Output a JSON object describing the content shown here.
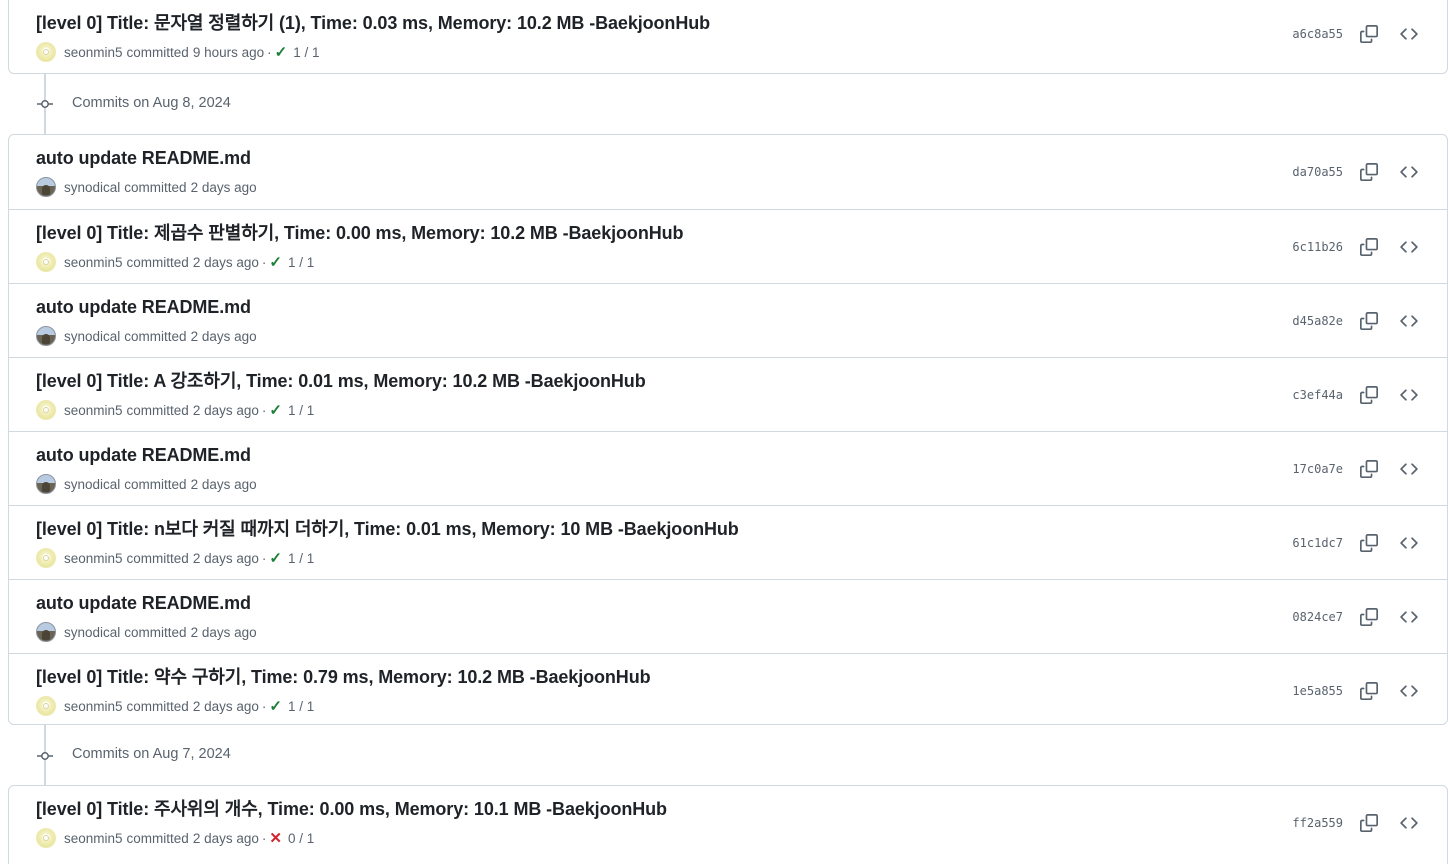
{
  "top_group": {
    "commits": [
      {
        "title": "[level 0] Title: 문자열 정렬하기 (1), Time: 0.03 ms, Memory: 10.2 MB -BaekjoonHub",
        "author": "seonmin5",
        "verb": "committed",
        "time": "9 hours ago",
        "status": "success",
        "status_count": "1 / 1",
        "sha": "a6c8a55"
      }
    ]
  },
  "groups": [
    {
      "label": "Commits on Aug 8, 2024",
      "commits": [
        {
          "title": "auto update README.md",
          "author": "synodical",
          "verb": "committed",
          "time": "2 days ago",
          "status": "",
          "status_count": "",
          "sha": "da70a55"
        },
        {
          "title": "[level 0] Title: 제곱수 판별하기, Time: 0.00 ms, Memory: 10.2 MB -BaekjoonHub",
          "author": "seonmin5",
          "verb": "committed",
          "time": "2 days ago",
          "status": "success",
          "status_count": "1 / 1",
          "sha": "6c11b26"
        },
        {
          "title": "auto update README.md",
          "author": "synodical",
          "verb": "committed",
          "time": "2 days ago",
          "status": "",
          "status_count": "",
          "sha": "d45a82e"
        },
        {
          "title": "[level 0] Title: A 강조하기, Time: 0.01 ms, Memory: 10.2 MB -BaekjoonHub",
          "author": "seonmin5",
          "verb": "committed",
          "time": "2 days ago",
          "status": "success",
          "status_count": "1 / 1",
          "sha": "c3ef44a"
        },
        {
          "title": "auto update README.md",
          "author": "synodical",
          "verb": "committed",
          "time": "2 days ago",
          "status": "",
          "status_count": "",
          "sha": "17c0a7e"
        },
        {
          "title": "[level 0] Title: n보다 커질 때까지 더하기, Time: 0.01 ms, Memory: 10 MB -BaekjoonHub",
          "author": "seonmin5",
          "verb": "committed",
          "time": "2 days ago",
          "status": "success",
          "status_count": "1 / 1",
          "sha": "61c1dc7"
        },
        {
          "title": "auto update README.md",
          "author": "synodical",
          "verb": "committed",
          "time": "2 days ago",
          "status": "",
          "status_count": "",
          "sha": "0824ce7"
        },
        {
          "title": "[level 0] Title: 약수 구하기, Time: 0.79 ms, Memory: 10.2 MB -BaekjoonHub",
          "author": "seonmin5",
          "verb": "committed",
          "time": "2 days ago",
          "status": "success",
          "status_count": "1 / 1",
          "sha": "1e5a855"
        }
      ]
    },
    {
      "label": "Commits on Aug 7, 2024",
      "commits": [
        {
          "title": "[level 0] Title: 주사위의 개수, Time: 0.00 ms, Memory: 10.1 MB -BaekjoonHub",
          "author": "seonmin5",
          "verb": "committed",
          "time": "2 days ago",
          "status": "failure",
          "status_count": "0 / 1",
          "sha": "ff2a559"
        }
      ]
    }
  ],
  "icons": {
    "copy": "copy-icon",
    "browse": "code-icon",
    "success": "check-icon",
    "failure": "x-icon",
    "group": "git-commit-icon"
  },
  "colors": {
    "success": "#1a7f37",
    "failure": "#d1242f",
    "muted": "#59636e",
    "border": "#d1d9e0"
  }
}
